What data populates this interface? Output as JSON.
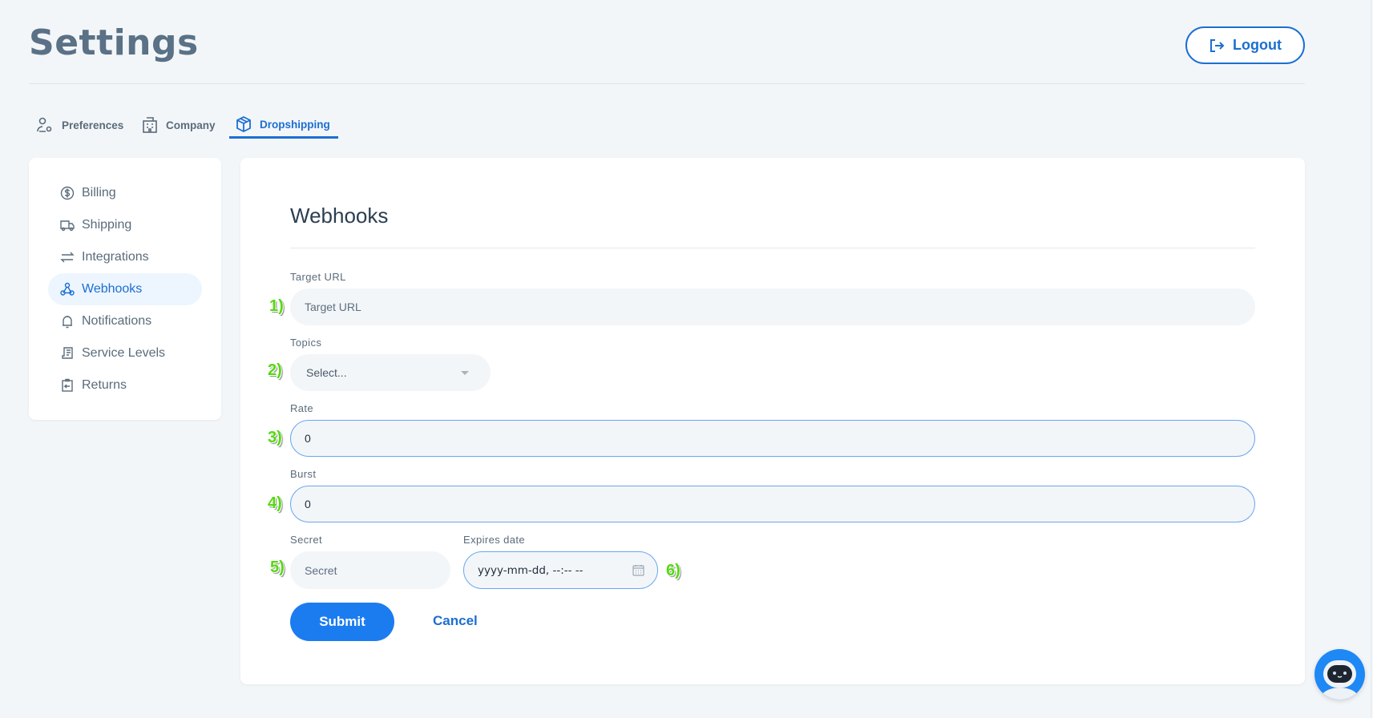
{
  "header": {
    "title": "Settings",
    "logout_label": "Logout"
  },
  "tabs": [
    {
      "label": "Preferences",
      "icon": "user-gear-icon"
    },
    {
      "label": "Company",
      "icon": "building-icon"
    },
    {
      "label": "Dropshipping",
      "icon": "box-icon",
      "active": true
    }
  ],
  "sidebar": {
    "items": [
      {
        "label": "Billing",
        "icon": "dollar-circle-icon"
      },
      {
        "label": "Shipping",
        "icon": "truck-icon"
      },
      {
        "label": "Integrations",
        "icon": "arrows-exchange-icon"
      },
      {
        "label": "Webhooks",
        "icon": "webhook-icon",
        "active": true
      },
      {
        "label": "Notifications",
        "icon": "bell-icon"
      },
      {
        "label": "Service Levels",
        "icon": "receipt-icon"
      },
      {
        "label": "Returns",
        "icon": "return-icon"
      }
    ]
  },
  "form": {
    "title": "Webhooks",
    "target_url": {
      "label": "Target URL",
      "placeholder": "Target URL",
      "marker": "1)"
    },
    "topics": {
      "label": "Topics",
      "value": "Select...",
      "marker": "2)"
    },
    "rate": {
      "label": "Rate",
      "value": "0",
      "marker": "3)"
    },
    "burst": {
      "label": "Burst",
      "value": "0",
      "marker": "4)"
    },
    "secret": {
      "label": "Secret",
      "placeholder": "Secret",
      "marker": "5)"
    },
    "expires": {
      "label": "Expires date",
      "value": "yyyy-mm-dd, --:-- --",
      "marker": "6)"
    },
    "submit_label": "Submit",
    "cancel_label": "Cancel"
  },
  "colors": {
    "accent": "#1b6fd1",
    "button": "#1b7cf0",
    "marker": "#55d911"
  }
}
